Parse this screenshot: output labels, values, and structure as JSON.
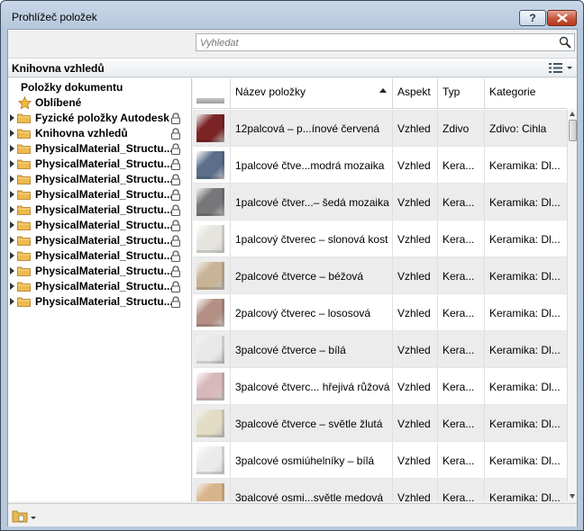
{
  "window": {
    "title": "Prohlížeč položek",
    "help_label": "?"
  },
  "search": {
    "placeholder": "Vyhledat"
  },
  "library": {
    "title": "Knihovna vzhledů"
  },
  "tree": {
    "root": "Položky dokumentu",
    "favorites": "Oblíbené",
    "folders": [
      "Fyzické položky Autodesk",
      "Knihovna vzhledů",
      "PhysicalMaterial_Structu...",
      "PhysicalMaterial_Structu...",
      "PhysicalMaterial_Structu...",
      "PhysicalMaterial_Structu...",
      "PhysicalMaterial_Structu...",
      "PhysicalMaterial_Structu...",
      "PhysicalMaterial_Structu...",
      "PhysicalMaterial_Structu...",
      "PhysicalMaterial_Structu...",
      "PhysicalMaterial_Structu...",
      "PhysicalMaterial_Structu..."
    ]
  },
  "table": {
    "columns": [
      "Název položky",
      "Aspekt",
      "Typ",
      "Kategorie"
    ],
    "rows": [
      {
        "name": "12palcová – p...ínové červená",
        "aspect": "Vzhled",
        "type": "Zdivo",
        "category": "Zdivo: Cihla",
        "swatch": "#7b2426"
      },
      {
        "name": "1palcové čtve...modrá mozaika",
        "aspect": "Vzhled",
        "type": "Kera...",
        "category": "Keramika: Dl...",
        "swatch": "#5b6f8a"
      },
      {
        "name": "1palcové čtver...– šedá mozaika",
        "aspect": "Vzhled",
        "type": "Kera...",
        "category": "Keramika: Dl...",
        "swatch": "#77777a"
      },
      {
        "name": "1palcový čtverec – slonová kost",
        "aspect": "Vzhled",
        "type": "Kera...",
        "category": "Keramika: Dl...",
        "swatch": "#e6e4de"
      },
      {
        "name": "2palcové čtverce – béžová",
        "aspect": "Vzhled",
        "type": "Kera...",
        "category": "Keramika: Dl...",
        "swatch": "#c9b396"
      },
      {
        "name": "2palcový čtverec – lososová",
        "aspect": "Vzhled",
        "type": "Kera...",
        "category": "Keramika: Dl...",
        "swatch": "#b48f84"
      },
      {
        "name": "3palcové čtverce – bílá",
        "aspect": "Vzhled",
        "type": "Kera...",
        "category": "Keramika: Dl...",
        "swatch": "#e8e8e8"
      },
      {
        "name": "3palcové čtverc... hřejivá růžová",
        "aspect": "Vzhled",
        "type": "Kera...",
        "category": "Keramika: Dl...",
        "swatch": "#d8b9bb"
      },
      {
        "name": "3palcové čtverce – světle žlutá",
        "aspect": "Vzhled",
        "type": "Kera...",
        "category": "Keramika: Dl...",
        "swatch": "#e2dcc4"
      },
      {
        "name": "3palcové osmiúhelníky – bílá",
        "aspect": "Vzhled",
        "type": "Kera...",
        "category": "Keramika: Dl...",
        "swatch": "#ebebeb"
      },
      {
        "name": "3palcové osmi...světle medová",
        "aspect": "Vzhled",
        "type": "Kera...",
        "category": "Keramika: Dl...",
        "swatch": "#d9b38a"
      }
    ]
  }
}
